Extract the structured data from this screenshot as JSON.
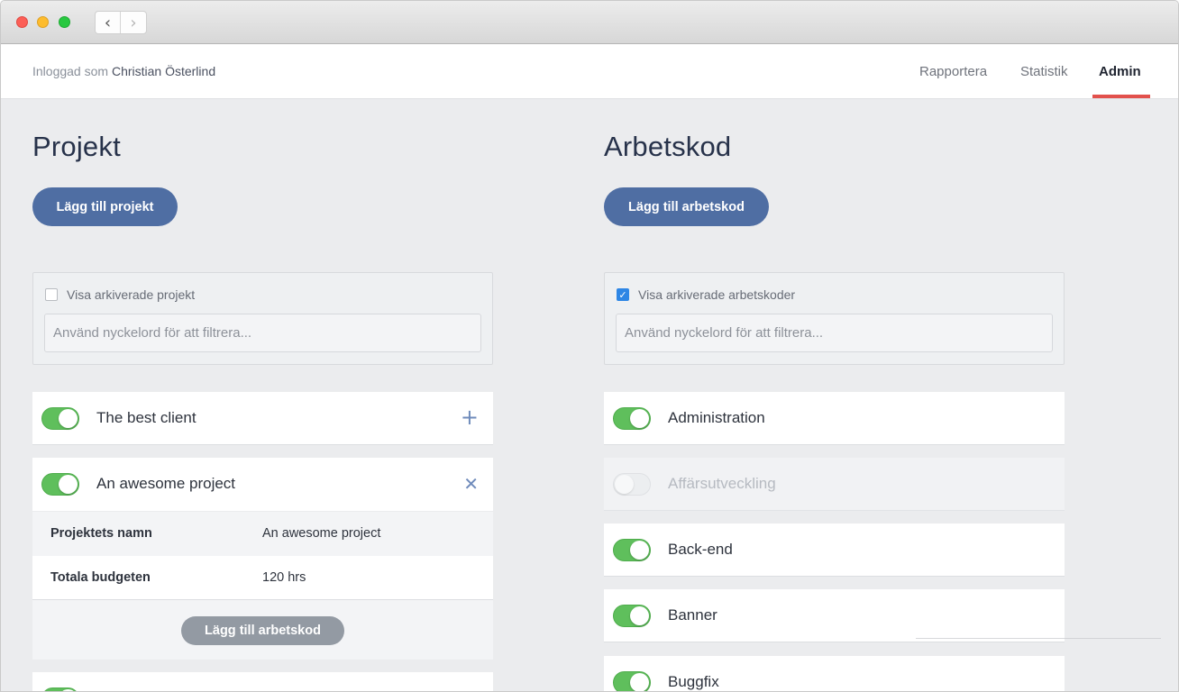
{
  "header": {
    "login_prefix": "Inloggad som",
    "login_user": "Christian Österlind",
    "nav": [
      {
        "label": "Rapportera",
        "active": false
      },
      {
        "label": "Statistik",
        "active": false
      },
      {
        "label": "Admin",
        "active": true
      }
    ],
    "accent_color": "#e2514c"
  },
  "projects": {
    "title": "Projekt",
    "add_button": "Lägg till projekt",
    "filter": {
      "show_archived_label": "Visa arkiverade projekt",
      "show_archived_checked": false,
      "search_placeholder": "Använd nyckelord för att filtrera..."
    },
    "items": [
      {
        "name": "The best client",
        "enabled": true,
        "action_icon": "plus-icon",
        "action_glyph": "+"
      },
      {
        "name": "An awesome project",
        "enabled": true,
        "action_icon": "close-icon",
        "action_glyph": "✕",
        "expanded": true
      }
    ],
    "detail": {
      "name_key": "Projektets namn",
      "name_value": "An awesome project",
      "budget_key": "Totala budgeten",
      "budget_value": "120 hrs",
      "add_code_button": "Lägg till arbetskod"
    }
  },
  "workcodes": {
    "title": "Arbetskod",
    "add_button": "Lägg till arbetskod",
    "filter": {
      "show_archived_label": "Visa arkiverade arbetskoder",
      "show_archived_checked": true,
      "search_placeholder": "Använd nyckelord för att filtrera..."
    },
    "items": [
      {
        "name": "Administration",
        "enabled": true
      },
      {
        "name": "Affärsutveckling",
        "enabled": false
      },
      {
        "name": "Back-end",
        "enabled": true
      },
      {
        "name": "Banner",
        "enabled": true
      },
      {
        "name": "Buggfix",
        "enabled": true
      }
    ]
  },
  "colors": {
    "primary_button": "#4f6ea3",
    "toggle_on": "#5fbf5c",
    "heading": "#27324a"
  }
}
